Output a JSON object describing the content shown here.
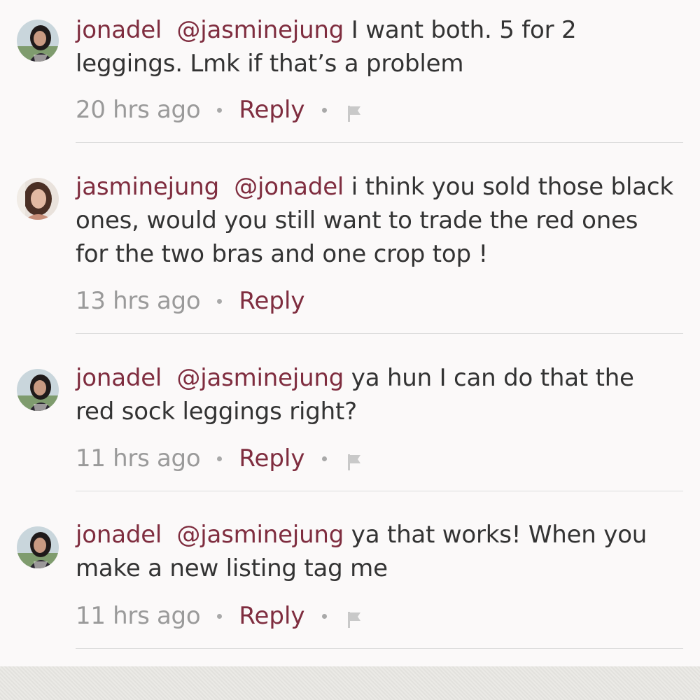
{
  "comments": [
    {
      "username": "jonadel",
      "mention": "@jasminejung",
      "text": "I want both. 5 for 2 leggings. Lmk if that’s a problem",
      "time": "20 hrs ago",
      "reply_label": "Reply",
      "has_flag": true,
      "avatar": "jonadel-avatar"
    },
    {
      "username": "jasminejung",
      "mention": "@jonadel",
      "text": "i think you sold those black ones, would you still want to trade the red ones for the two bras and one crop top !",
      "time": "13 hrs ago",
      "reply_label": "Reply",
      "has_flag": false,
      "avatar": "jasminejung-avatar"
    },
    {
      "username": "jonadel",
      "mention": "@jasminejung",
      "text": "ya hun I can do that the red sock leggings right?",
      "time": "11 hrs ago",
      "reply_label": "Reply",
      "has_flag": true,
      "avatar": "jonadel-avatar"
    },
    {
      "username": "jonadel",
      "mention": "@jasminejung",
      "text": "ya that works! When you make a new listing tag me",
      "time": "11 hrs ago",
      "reply_label": "Reply",
      "has_flag": true,
      "avatar": "jonadel-avatar"
    }
  ],
  "colors": {
    "accent": "#7f2d3f",
    "text": "#333333",
    "muted": "#9a9a9a",
    "background": "#fbf9f9"
  },
  "icons": {
    "flag": "flag-icon",
    "separator": "dot-separator"
  }
}
